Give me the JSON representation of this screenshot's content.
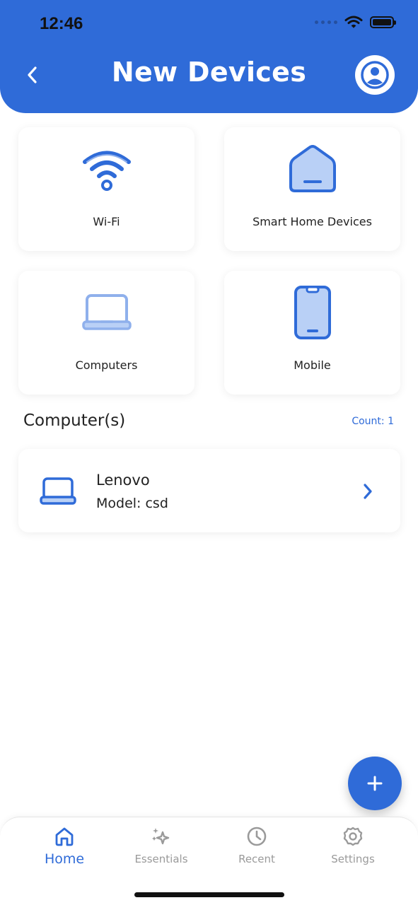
{
  "status_bar": {
    "time": "12:46"
  },
  "header": {
    "title": "New Devices",
    "back_icon": "chevron-left-icon",
    "profile_icon": "user-circle-icon"
  },
  "categories": [
    {
      "label": "Wi-Fi",
      "icon": "wifi-icon"
    },
    {
      "label": "Smart Home Devices",
      "icon": "house-icon"
    },
    {
      "label": "Computers",
      "icon": "laptop-icon"
    },
    {
      "label": "Mobile",
      "icon": "phone-icon"
    }
  ],
  "section": {
    "title": "Computer(s)",
    "count": "Count: 1"
  },
  "devices": [
    {
      "name": "Lenovo",
      "model": "Model: csd",
      "icon": "laptop-icon"
    }
  ],
  "fab": {
    "icon": "plus-icon"
  },
  "tabs": [
    {
      "label": "Home",
      "icon": "home-icon",
      "active": true
    },
    {
      "label": "Essentials",
      "icon": "sparkles-icon",
      "active": false
    },
    {
      "label": "Recent",
      "icon": "clock-icon",
      "active": false
    },
    {
      "label": "Settings",
      "icon": "gear-icon",
      "active": false
    }
  ],
  "colors": {
    "primary": "#2f6bd8",
    "light_primary": "#8fb0ec",
    "fill_light": "#b9d0f6",
    "inactive": "#9a9a9a"
  }
}
